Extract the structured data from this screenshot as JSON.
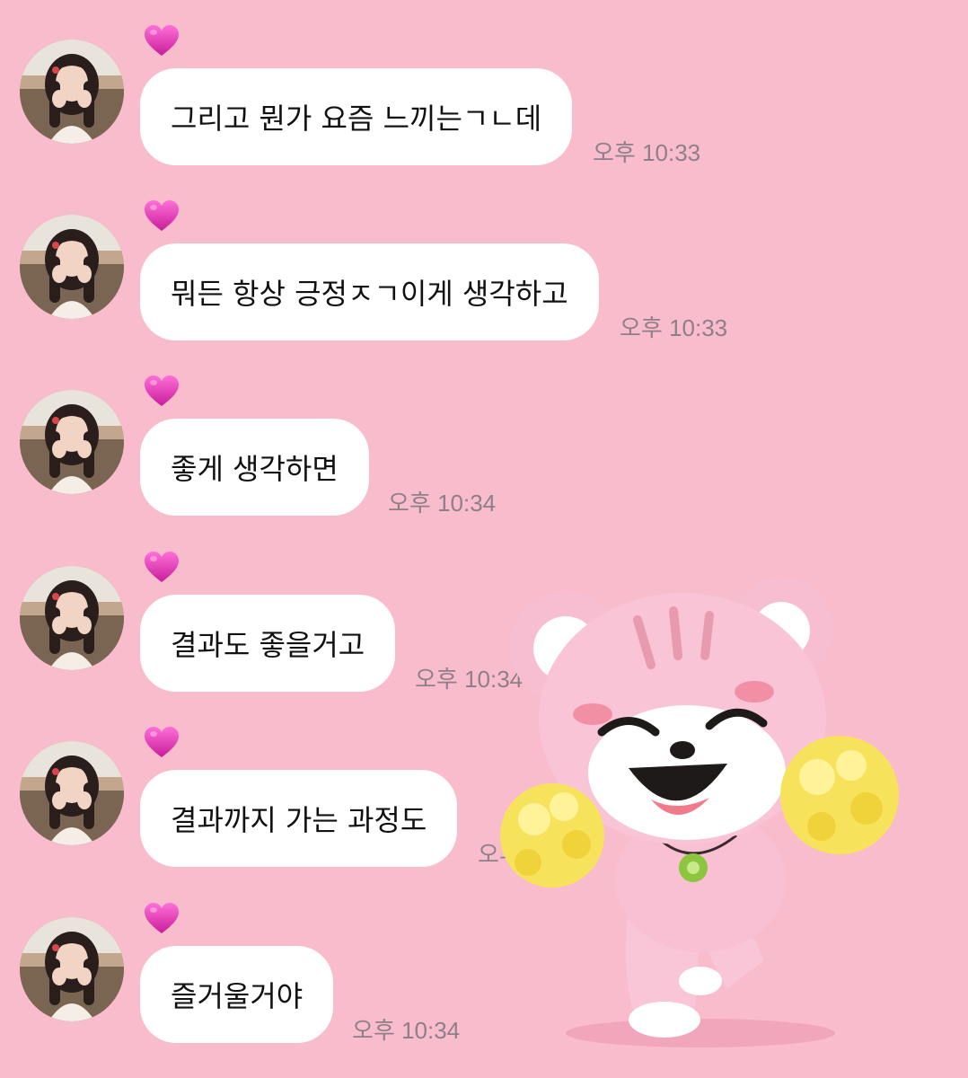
{
  "chat": {
    "messages": [
      {
        "text": "그리고 뭔가 요즘 느끼는ㄱㄴ데",
        "time": "오후 10:33",
        "reaction": "heart-icon"
      },
      {
        "text": "뭐든 항상 긍정ㅈㄱ이게 생각하고",
        "time": "오후 10:33",
        "reaction": "heart-icon"
      },
      {
        "text": "좋게 생각하면",
        "time": "오후 10:34",
        "reaction": "heart-icon"
      },
      {
        "text": "결과도 좋을거고",
        "time": "오후 10:34",
        "reaction": "heart-icon"
      },
      {
        "text": "결과까지 가는 과정도",
        "time": "오후 10:34",
        "reaction": "heart-icon"
      },
      {
        "text": "즐거울거야",
        "time": "오후 10:34",
        "reaction": "heart-icon"
      }
    ]
  },
  "sticker": {
    "icon": "bear-cheerleader-sticker"
  },
  "colors": {
    "background": "#f9bccd",
    "bubble": "#ffffff",
    "heart": "#e83fb8",
    "timestamp": "#8e8088"
  }
}
